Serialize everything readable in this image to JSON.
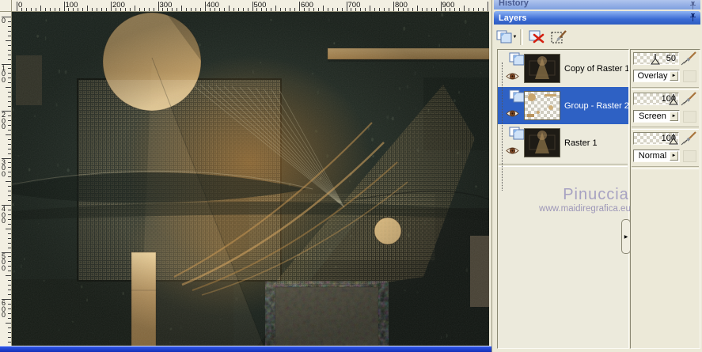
{
  "rulers": {
    "top_labels": [
      "0",
      "100",
      "200",
      "300",
      "400",
      "500",
      "600",
      "700",
      "800",
      "900"
    ],
    "left_labels": [
      "0",
      "100",
      "200",
      "300",
      "400",
      "500",
      "600"
    ]
  },
  "history_panel": {
    "title": "History",
    "pin_icon": "pushpin-icon"
  },
  "layers_panel": {
    "title": "Layers",
    "pin_icon": "pushpin-icon",
    "toolbar": {
      "new_layer_icon": "new-layer-pages-icon",
      "new_layer_dropdown": "dropdown-arrow-icon",
      "delete_layer_icon": "delete-layer-icon",
      "edit_selection_icon": "edit-selection-brush-icon"
    },
    "layers": [
      {
        "name": "Copy of Raster 1",
        "opacity": 50,
        "blend_mode": "Overlay",
        "selected": false,
        "visible": true,
        "thumbnail": "artwork"
      },
      {
        "name": "Group - Raster 2",
        "opacity": 100,
        "blend_mode": "Screen",
        "selected": true,
        "visible": true,
        "thumbnail": "transparent"
      },
      {
        "name": "Raster 1",
        "opacity": 100,
        "blend_mode": "Normal",
        "selected": false,
        "visible": true,
        "thumbnail": "artwork"
      }
    ]
  },
  "watermark": {
    "line1": "Pinuccia",
    "line2": "www.maidiregrafica.eu"
  },
  "colors": {
    "selection_blue": "#2e61c4",
    "panel_beige": "#ece9d8",
    "titlebar_blue": "#3c6cd4",
    "canvas_bg": "#20291f",
    "canvas_tan": "#c9a96e",
    "canvas_orange": "#c98636",
    "window_border_blue": "#2443d8"
  }
}
